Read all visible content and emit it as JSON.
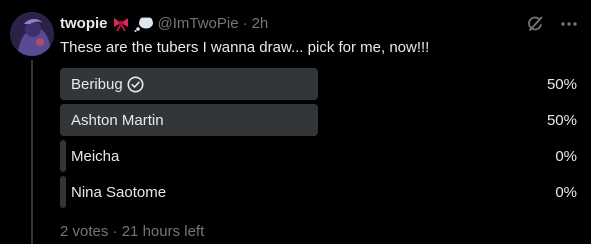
{
  "tweet": {
    "display_name": "twopie",
    "handle": "@ImTwoPie",
    "separator": "·",
    "time": "2h",
    "text": "These are the tubers I wanna draw... pick for me, now!!!",
    "emojis": [
      "ribbon-emoji",
      "thought-balloon-emoji"
    ]
  },
  "poll": {
    "options": [
      {
        "label": "Beribug",
        "percent": "50%",
        "fraction": 0.5,
        "selected": true
      },
      {
        "label": "Ashton Martin",
        "percent": "50%",
        "fraction": 0.5,
        "selected": false
      },
      {
        "label": "Meicha",
        "percent": "0%",
        "fraction": 0,
        "selected": false
      },
      {
        "label": "Nina Saotome",
        "percent": "0%",
        "fraction": 0,
        "selected": false
      }
    ],
    "votes": "2 votes",
    "separator": "·",
    "time_left": "21 hours left",
    "bar_color": "#333639"
  },
  "icons": {
    "grok": "grok-icon",
    "more": "more-icon",
    "check": "check-circle-icon"
  }
}
